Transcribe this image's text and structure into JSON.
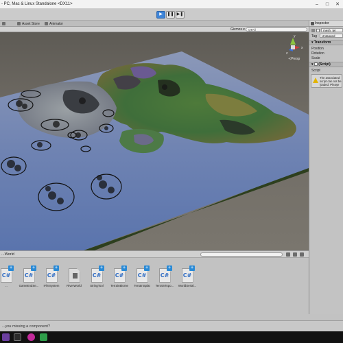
{
  "window": {
    "title": "- PC, Mac & Linux Standalone <DX11>"
  },
  "playback": {
    "play_icon": "play-icon",
    "pause_icon": "pause-icon",
    "step_icon": "step-icon"
  },
  "tabs": {
    "asset_store": "Asset Store",
    "animator": "Animator"
  },
  "scene": {
    "gizmos_label": "Gizmos ▾",
    "search_placeholder": "Q▾All",
    "persp_label": "≺Persp",
    "axis_labels": {
      "x": "x",
      "y": "y",
      "z": "z"
    }
  },
  "inspector": {
    "tab_label": "Inspector",
    "object_name": "mesh_ter",
    "tag_label": "Tag",
    "tag_value": "Untagged",
    "transform_header": "Transform",
    "transform_rows": [
      "Position",
      "Rotation",
      "Scale"
    ],
    "script_header": "(Script)",
    "script_label": "Script",
    "warning_text": "The associated script can not be loaded. Please fix any compile errors and assign a valid script."
  },
  "project": {
    "breadcrumb": "...World",
    "assets": [
      {
        "name": "...",
        "type": "cs"
      },
      {
        "name": "GameEndSe...",
        "type": "cs"
      },
      {
        "name": "IFileSystem",
        "type": "cs"
      },
      {
        "name": "RiverWorld",
        "type": "prefab"
      },
      {
        "name": "StringTool",
        "type": "cs"
      },
      {
        "name": "TerrainBiome",
        "type": "cs"
      },
      {
        "name": "TerrainSplat",
        "type": "cs"
      },
      {
        "name": "TerrainTopo...",
        "type": "cs"
      },
      {
        "name": "WorldSerial...",
        "type": "cs"
      }
    ],
    "cs_glyph": "C#"
  },
  "status": {
    "message": "...you missing a component?"
  },
  "colors": {
    "accent": "#3d84d8",
    "ocean_plane": "#6f83b2",
    "plane_edge": "#2d3f1e"
  },
  "taskbar_icons": [
    "visual-studio-icon",
    "unity-icon",
    "browser-icon",
    "app-icon-purple",
    "app-icon-green"
  ]
}
